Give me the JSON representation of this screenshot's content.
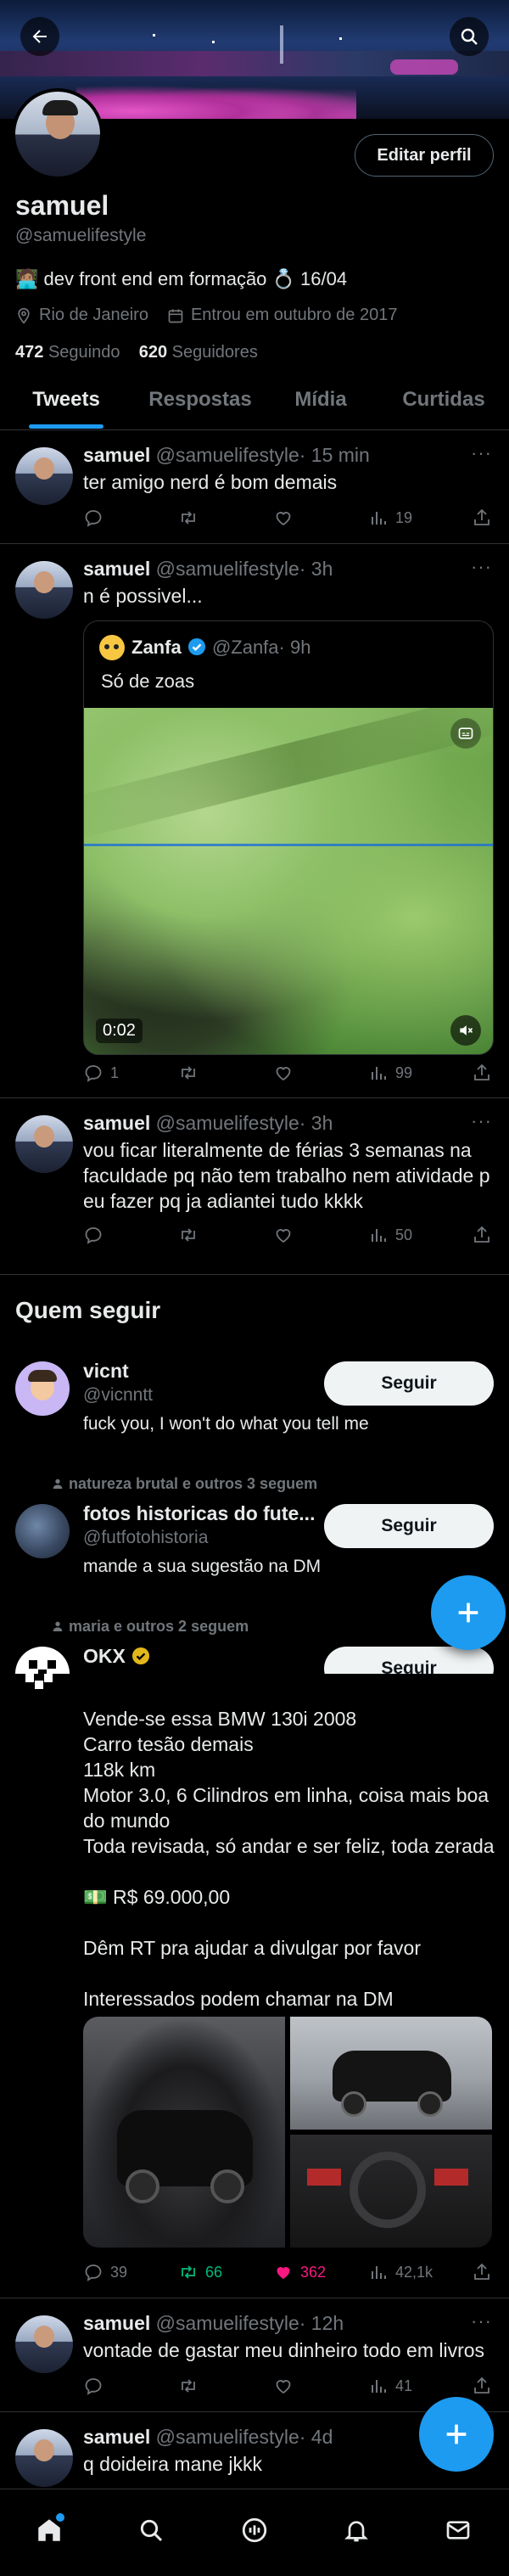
{
  "header": {
    "back_icon": "arrow-left-icon",
    "search_icon": "search-icon",
    "edit_label": "Editar perfil"
  },
  "profile": {
    "name": "samuel",
    "handle": "@samuelifestyle",
    "bio": "🧑🏽‍💻 dev front end em formação 💍 16/04",
    "location": "Rio de Janeiro",
    "joined": "Entrou em outubro de 2017",
    "following_count": "472",
    "following_label": "Seguindo",
    "followers_count": "620",
    "followers_label": "Seguidores"
  },
  "tabs": [
    {
      "label": "Tweets",
      "active": true
    },
    {
      "label": "Respostas",
      "active": false
    },
    {
      "label": "Mídia",
      "active": false
    },
    {
      "label": "Curtidas",
      "active": false
    }
  ],
  "tweets": [
    {
      "name": "samuel",
      "handle": "@samuelifestyle",
      "time": "· 15 min",
      "text": "ter amigo nerd é bom demais",
      "replies": "",
      "retweets": "",
      "likes": "",
      "views": "19"
    },
    {
      "name": "samuel",
      "handle": "@samuelifestyle",
      "time": "· 3h",
      "text": "n é possivel...",
      "replies": "1",
      "retweets": "",
      "likes": "",
      "views": "99",
      "quote": {
        "name": "Zanfa",
        "handle": "@Zanfa",
        "time": "· 9h",
        "text": "Só de zoas",
        "video_time": "0:02"
      }
    },
    {
      "name": "samuel",
      "handle": "@samuelifestyle",
      "time": "· 3h",
      "text": "vou ficar literalmente de férias 3 semanas na faculdade pq não tem trabalho nem atividade p eu fazer pq ja adiantei tudo kkkk",
      "replies": "",
      "retweets": "",
      "likes": "",
      "views": "50"
    }
  ],
  "who_to_follow": {
    "title": "Quem seguir",
    "follow_label": "Seguir",
    "users": [
      {
        "name": "vicnt",
        "handle": "@vicnntt",
        "bio": "fuck you, I won't do what you tell me",
        "social": ""
      },
      {
        "name": "fotos historicas do fute...",
        "handle": "@futfotohistoria",
        "bio": "mande a sua sugestão na DM",
        "social": "natureza brutal e outros 3 seguem"
      },
      {
        "name": "OKX",
        "handle": "",
        "bio": "",
        "social": "maria e outros 2 seguem"
      }
    ]
  },
  "bmw_tweet": {
    "lines": [
      "Vende-se essa BMW 130i 2008",
      "Carro tesão demais",
      "118k km",
      "Motor 3.0, 6 Cilindros em linha, coisa mais boa do mundo",
      "Toda revisada, só andar e ser feliz, toda zerada",
      "💵 R$ 69.000,00",
      "Dêm RT pra ajudar a divulgar por favor",
      "Interessados podem chamar na DM"
    ],
    "replies": "39",
    "retweets": "66",
    "likes": "362",
    "views": "42,1k"
  },
  "tweets_bottom": [
    {
      "name": "samuel",
      "handle": "@samuelifestyle",
      "time": "· 12h",
      "text": "vontade de gastar meu dinheiro todo em livros",
      "replies": "",
      "retweets": "",
      "likes": "",
      "views": "41"
    },
    {
      "name": "samuel",
      "handle": "@samuelifestyle",
      "time": "· 4d",
      "text": "q doideira mane jkkk"
    }
  ],
  "bottom_nav": [
    "home-icon",
    "search-icon",
    "spaces-icon",
    "bell-icon",
    "mail-icon"
  ],
  "fab_icon": "plus-icon",
  "colors": {
    "accent": "#1d9bf0",
    "bg": "#000000",
    "muted": "#71767b",
    "like": "#f91880",
    "retweet": "#00ba7c"
  }
}
